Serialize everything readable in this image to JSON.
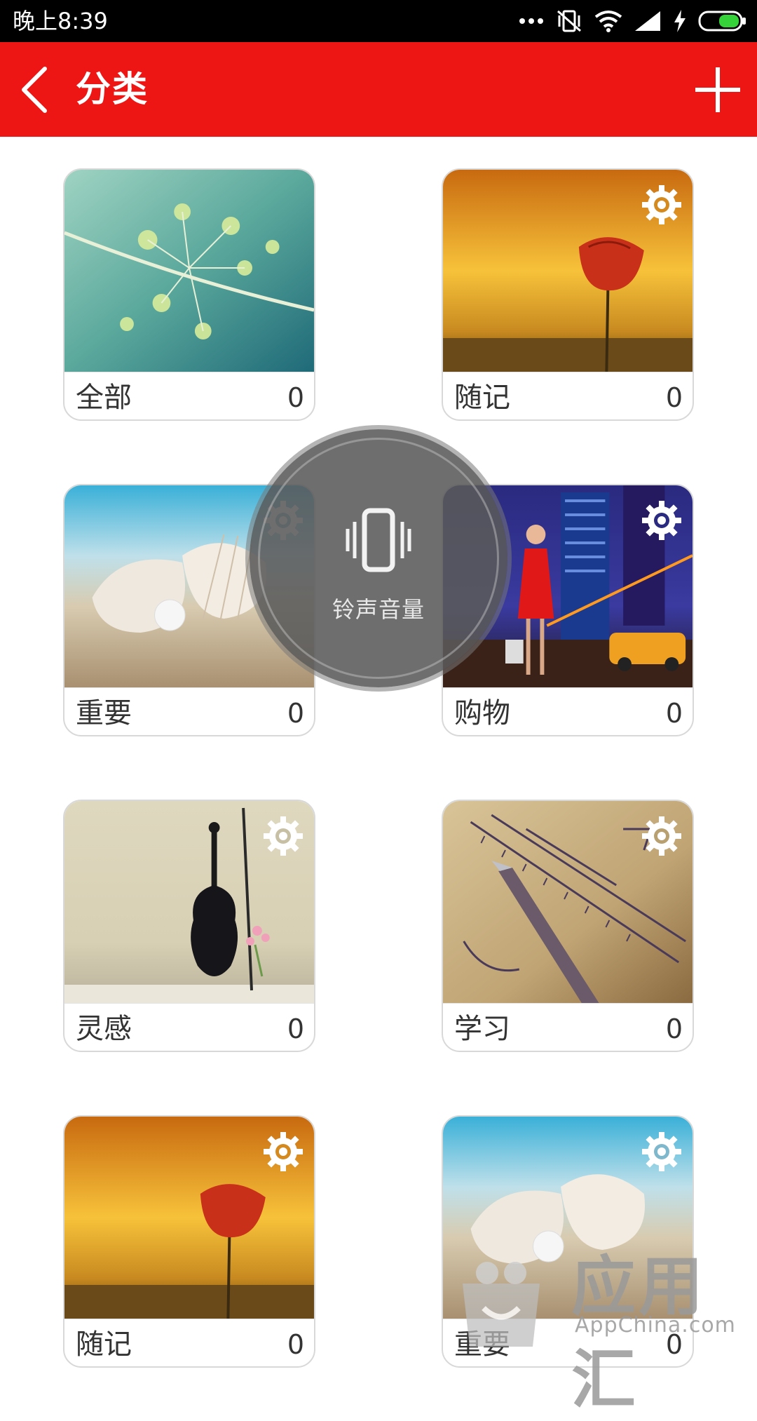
{
  "status_bar": {
    "time": "晚上8:39",
    "icons": [
      "more-dots-icon",
      "vibrate-off-icon",
      "wifi-icon",
      "signal-icon",
      "charging-icon",
      "battery-icon"
    ]
  },
  "app_bar": {
    "title": "分类",
    "back_icon": "back-arrow-icon",
    "add_icon": "add-icon",
    "background": "#ee1515"
  },
  "categories": [
    {
      "name": "全部",
      "count": "0",
      "image": "green-plant",
      "has_settings": false
    },
    {
      "name": "随记",
      "count": "0",
      "image": "sunset-poppy",
      "has_settings": true
    },
    {
      "name": "重要",
      "count": "0",
      "image": "shell-pearl",
      "has_settings": true
    },
    {
      "name": "购物",
      "count": "0",
      "image": "city-shopper",
      "has_settings": true
    },
    {
      "name": "灵感",
      "count": "0",
      "image": "violin",
      "has_settings": true
    },
    {
      "name": "学习",
      "count": "0",
      "image": "missing-data-notes",
      "has_settings": true
    },
    {
      "name": "随记",
      "count": "0",
      "image": "sunset-poppy",
      "has_settings": true
    },
    {
      "name": "重要",
      "count": "0",
      "image": "shell-pearl",
      "has_settings": true
    }
  ],
  "volume_overlay": {
    "label": "铃声音量",
    "icon": "vibrate-icon"
  },
  "watermark": {
    "text_cn": "应用汇",
    "text_en": "AppChina.com"
  }
}
